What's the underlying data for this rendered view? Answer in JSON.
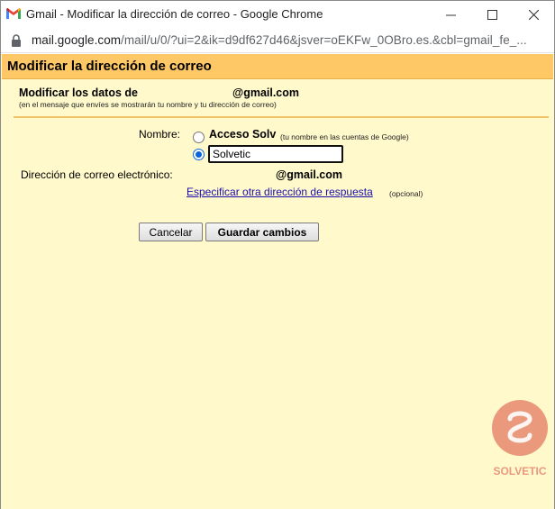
{
  "window": {
    "title": "Gmail - Modificar la dirección de correo - Google Chrome"
  },
  "address_bar": {
    "host": "mail.google.com",
    "path": "/mail/u/0/?ui=2&ik=d9df627d46&jsver=oEKFw_0OBro.es.&cbl=gmail_fe_..."
  },
  "dialog": {
    "header_title": "Modificar la dirección de correo",
    "section_title": "Modificar los datos de",
    "section_email": "@gmail.com",
    "section_note": "(en el mensaje que envíes se mostrarán tu nombre y tu dirección de correo)",
    "name_label": "Nombre:",
    "name_option_label": "Acceso Solv",
    "name_option_hint": "(tu nombre en las cuentas de Google)",
    "custom_name_value": "Solvetic",
    "email_label": "Dirección de correo electrónico:",
    "email_value": "@gmail.com",
    "reply_link": "Especificar otra dirección de respuesta",
    "reply_optional": "(opcional)",
    "cancel_label": "Cancelar",
    "save_label": "Guardar cambios"
  },
  "watermark": {
    "brand": "SOLVETIC"
  },
  "colors": {
    "header_bg": "#fdc865",
    "content_bg": "#fff9cc",
    "divider": "#f0c466",
    "link": "#1a0dab",
    "radio_selected": "#0a66d8"
  },
  "icons": [
    "gmail-logo-icon",
    "minimize-icon",
    "maximize-icon",
    "close-icon",
    "lock-icon",
    "solvetic-logo-icon"
  ]
}
